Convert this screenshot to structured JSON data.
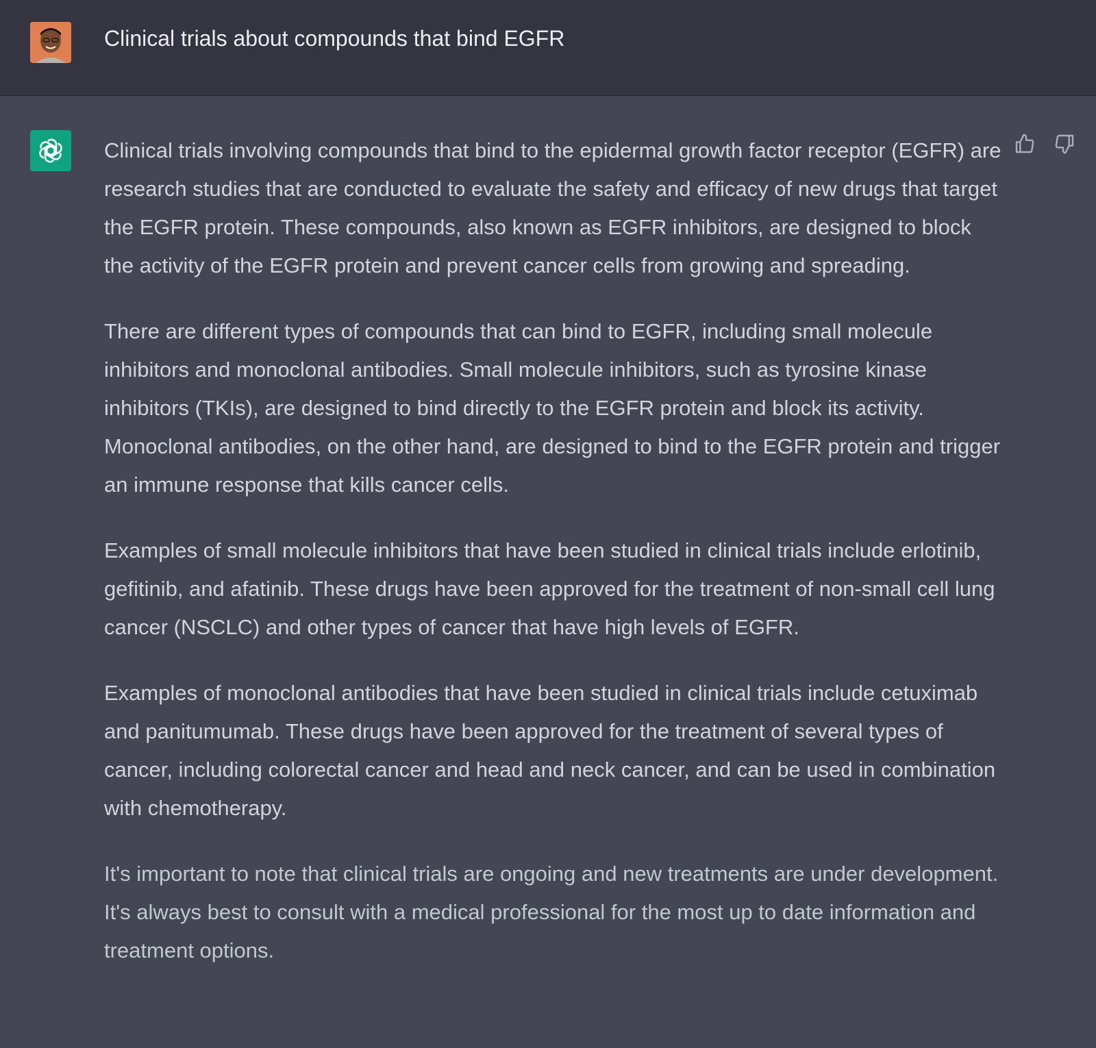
{
  "user_message": {
    "avatar_icon": "user-avatar-photo",
    "text": "Clinical trials about compounds that bind EGFR"
  },
  "assistant_message": {
    "logo_icon": "openai-logo-icon",
    "logo_color": "#10a37f",
    "paragraphs": [
      "Clinical trials involving compounds that bind to the epidermal growth factor receptor (EGFR) are research studies that are conducted to evaluate the safety and efficacy of new drugs that target the EGFR protein. These compounds, also known as EGFR inhibitors, are designed to block the activity of the EGFR protein and prevent cancer cells from growing and spreading.",
      "There are different types of compounds that can bind to EGFR, including small molecule inhibitors and monoclonal antibodies. Small molecule inhibitors, such as tyrosine kinase inhibitors (TKIs), are designed to bind directly to the EGFR protein and block its activity. Monoclonal antibodies, on the other hand, are designed to bind to the EGFR protein and trigger an immune response that kills cancer cells.",
      "Examples of small molecule inhibitors that have been studied in clinical trials include erlotinib, gefitinib, and afatinib. These drugs have been approved for the treatment of non-small cell lung cancer (NSCLC) and other types of cancer that have high levels of EGFR.",
      "Examples of monoclonal antibodies that have been studied in clinical trials include cetuximab and panitumumab. These drugs have been approved for the treatment of several types of cancer, including colorectal cancer and head and neck cancer, and can be used in combination with chemotherapy.",
      "It's important to note that clinical trials are ongoing and new treatments are under development. It's always best to consult with a medical professional for the most up to date information and treatment options."
    ],
    "feedback": {
      "thumbs_up_icon": "thumbs-up-icon",
      "thumbs_down_icon": "thumbs-down-icon"
    }
  },
  "colors": {
    "user_row_bg": "#343541",
    "assistant_row_bg": "#444654",
    "text": "#d1d5db"
  }
}
